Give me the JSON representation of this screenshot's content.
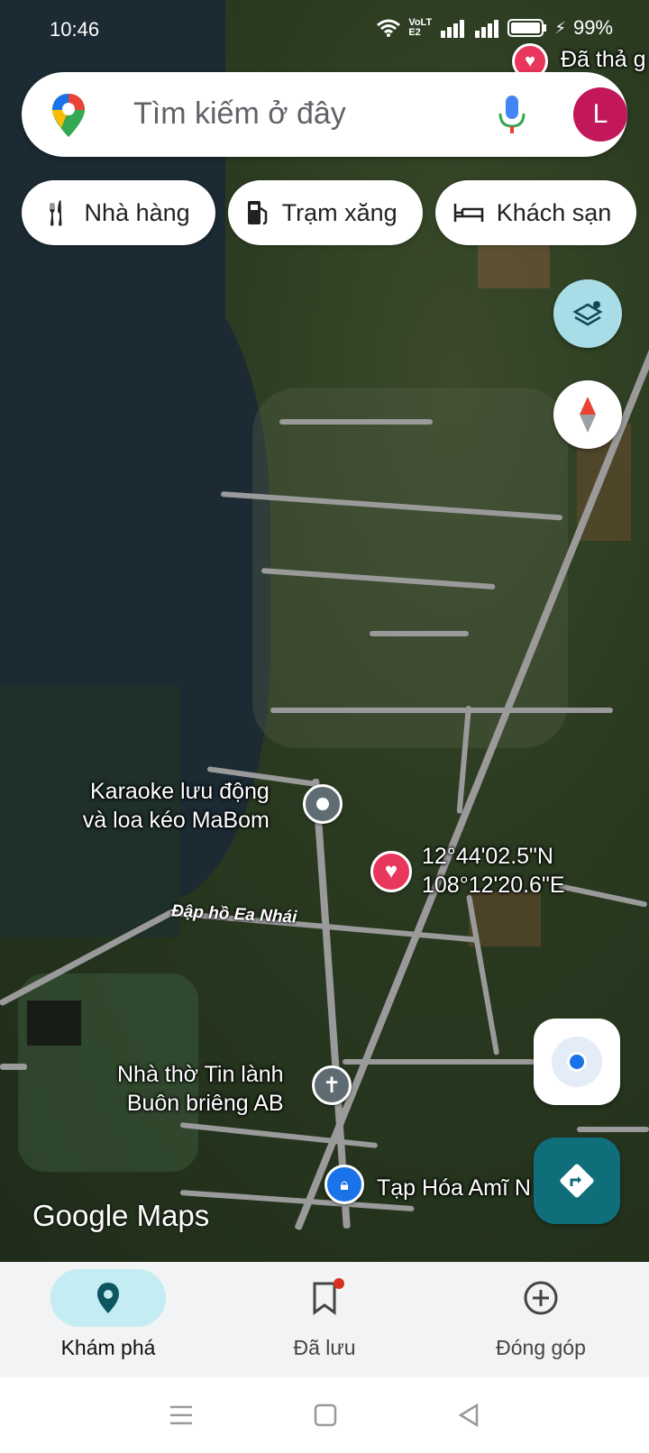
{
  "status_bar": {
    "time": "10:46",
    "battery": "99%",
    "net_badge": "VoLTE2"
  },
  "search": {
    "placeholder": "Tìm kiếm ở đây",
    "avatar_letter": "L"
  },
  "chips": [
    {
      "label": "Nhà hàng",
      "icon": "restaurant-icon"
    },
    {
      "label": "Trạm xăng",
      "icon": "gas-station-icon"
    },
    {
      "label": "Khách sạn",
      "icon": "hotel-icon"
    }
  ],
  "map": {
    "saved_top_label": "Đã thả g",
    "places": [
      {
        "line1": "Karaoke lưu động",
        "line2": "và loa kéo MaBom"
      },
      {
        "line1": "Nhà thờ Tin lành",
        "line2": "Buôn briêng AB"
      },
      {
        "line1": "Tạp Hóa Amĩ N"
      }
    ],
    "dropped_pin": {
      "lat": "12°44'02.5\"N",
      "lng": "108°12'20.6\"E"
    },
    "road_label": "Đập hồ Ea Nhái",
    "watermark": "Google Maps"
  },
  "bottom_nav": [
    {
      "label": "Khám phá",
      "icon": "explore-pin-icon",
      "active": true
    },
    {
      "label": "Đã lưu",
      "icon": "bookmark-icon",
      "active": false
    },
    {
      "label": "Đóng góp",
      "icon": "add-circle-icon",
      "active": false
    }
  ],
  "colors": {
    "accent_teal": "#0f6e7a",
    "active_pill": "#c3ecf3",
    "heart_pin": "#e8365d",
    "store_pin": "#1a73e8"
  }
}
